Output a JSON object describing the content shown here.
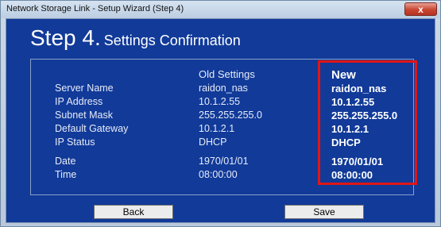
{
  "window": {
    "title": "Network Storage Link - Setup Wizard (Step 4)",
    "close_label": "x"
  },
  "heading": {
    "step": "Step 4.",
    "subtitle": "Settings Confirmation"
  },
  "columns": {
    "old": "Old Settings",
    "new": "New"
  },
  "rows": [
    {
      "label": "Server Name",
      "old": "raidon_nas",
      "new": "raidon_nas"
    },
    {
      "label": "IP Address",
      "old": "10.1.2.55",
      "new": "10.1.2.55"
    },
    {
      "label": "Subnet Mask",
      "old": "255.255.255.0",
      "new": "255.255.255.0"
    },
    {
      "label": "Default Gateway",
      "old": "10.1.2.1",
      "new": "10.1.2.1"
    },
    {
      "label": "IP Status",
      "old": "DHCP",
      "new": "DHCP"
    },
    {
      "label": "Date",
      "old": "1970/01/01",
      "new": "1970/01/01"
    },
    {
      "label": "Time",
      "old": "08:00:00",
      "new": "08:00:00"
    }
  ],
  "buttons": {
    "back": "Back",
    "save": "Save"
  },
  "colors": {
    "panel_bg": "#113a99",
    "highlight": "#e01616"
  }
}
